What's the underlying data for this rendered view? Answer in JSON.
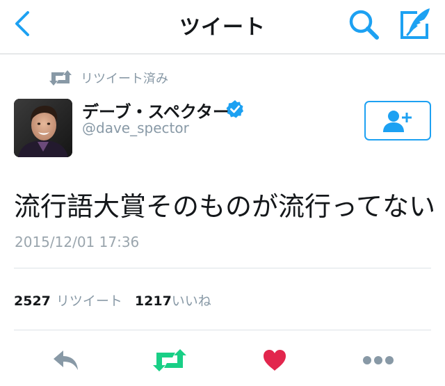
{
  "nav": {
    "title": "ツイート"
  },
  "retweet_context": {
    "label": "リツイート済み"
  },
  "author": {
    "name": "デーブ・スペクター",
    "handle": "@dave_spector"
  },
  "tweet": {
    "text": "流行語大賞そのものが流行ってない",
    "timestamp": "2015/12/01 17:36"
  },
  "stats": {
    "retweets_count": "2527",
    "retweets_label": "リツイート",
    "likes_count": "1217",
    "likes_label": "いいね"
  },
  "colors": {
    "accent": "#1da1f2",
    "retweet_active": "#19cf86",
    "like_active": "#e2264d",
    "muted": "#8899a6"
  },
  "icons": {
    "back": "chevron-left-icon",
    "search": "search-icon",
    "compose": "compose-icon",
    "retweet_context": "retweet-icon",
    "verified": "verified-badge-icon",
    "follow": "add-user-icon",
    "reply": "reply-icon",
    "retweet": "retweet-icon",
    "like": "heart-icon",
    "more": "more-dots-icon"
  }
}
